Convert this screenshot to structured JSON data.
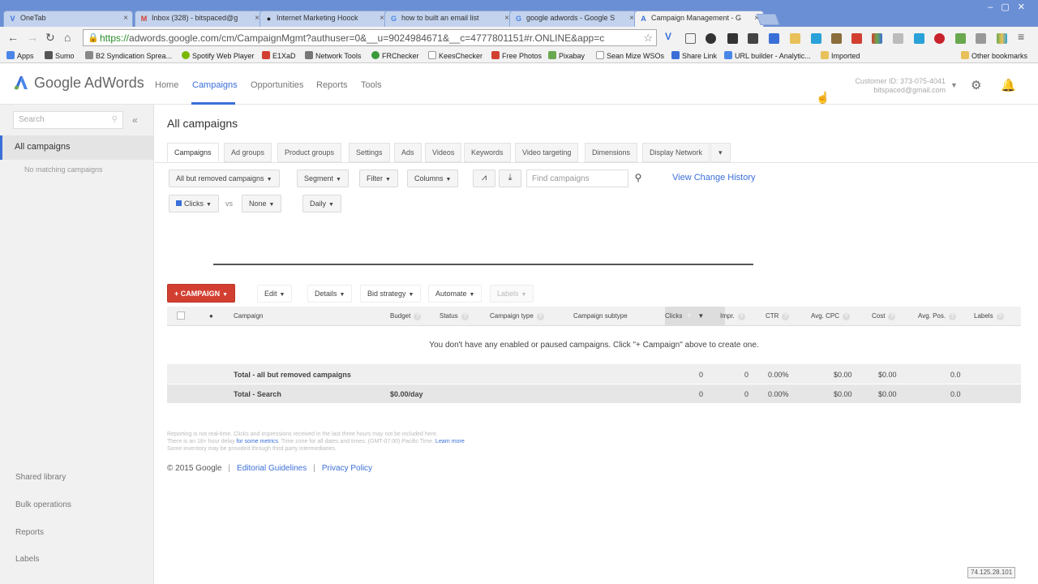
{
  "browser": {
    "tabs": [
      {
        "title": "OneTab",
        "icon": "V",
        "color": "#3a6fd8"
      },
      {
        "title": "Inbox (328) - bitspaced@g",
        "icon": "M",
        "color": "#d23f31"
      },
      {
        "title": "Internet Marketing Hoock",
        "icon": "●",
        "color": "#222"
      },
      {
        "title": "how to built an email list",
        "icon": "G",
        "color": "#4a86e8"
      },
      {
        "title": "google adwords - Google S",
        "icon": "G",
        "color": "#4a86e8"
      },
      {
        "title": "Campaign Management - G",
        "icon": "A",
        "color": "#3a6fd8"
      }
    ],
    "url_https": "https://",
    "url_rest": "adwords.google.com/cm/CampaignMgmt?authuser=0&__u=9024984671&__c=4777801151#r.ONLINE&app=c",
    "bookmarks": [
      {
        "label": "Apps",
        "color": "#4a86e8"
      },
      {
        "label": "Sumo",
        "color": "#555"
      },
      {
        "label": "B2 Syndication Sprea...",
        "color": "#888"
      },
      {
        "label": "Spotify Web Player",
        "color": "#7ab800"
      },
      {
        "label": "E1XaD",
        "color": "#d23f31"
      },
      {
        "label": "Network Tools",
        "color": "#777"
      },
      {
        "label": "FRChecker",
        "color": "#3a9a3a"
      },
      {
        "label": "KeesChecker",
        "color": "#888"
      },
      {
        "label": "Free Photos",
        "color": "#d23f31"
      },
      {
        "label": "Pixabay",
        "color": "#6aa84f"
      },
      {
        "label": "Sean Mize WSOs",
        "color": "#888"
      },
      {
        "label": "Share Link",
        "color": "#3a6fd8"
      },
      {
        "label": "URL builder - Analytic...",
        "color": "#4a86e8"
      },
      {
        "label": "Imported",
        "color": "#e8c15a"
      },
      {
        "label": "Other bookmarks",
        "color": "#e8c15a"
      }
    ]
  },
  "header": {
    "logo": "Google AdWords",
    "nav": [
      "Home",
      "Campaigns",
      "Opportunities",
      "Reports",
      "Tools"
    ],
    "customer_id": "Customer ID: 373-075-4041",
    "email": "bitspaced@gmail.com"
  },
  "sidebar": {
    "search_placeholder": "Search",
    "all_campaigns": "All campaigns",
    "no_match": "No matching campaigns",
    "links": [
      "Shared library",
      "Bulk operations",
      "Reports",
      "Labels"
    ]
  },
  "main": {
    "title": "All campaigns",
    "tabs": [
      "Campaigns",
      "Ad groups",
      "Product groups",
      "Settings",
      "Ads",
      "Videos",
      "Keywords",
      "Video targeting",
      "Dimensions",
      "Display Network",
      "▾"
    ],
    "filter_btn": "All but removed campaigns",
    "segment": "Segment",
    "filter": "Filter",
    "columns": "Columns",
    "find_placeholder": "Find campaigns",
    "change_history": "View Change History",
    "metric1": "Clicks",
    "vs": "vs",
    "metric2": "None",
    "period": "Daily",
    "campaign_btn": "+ CAMPAIGN",
    "edit": "Edit",
    "details": "Details",
    "bid_strategy": "Bid strategy",
    "automate": "Automate",
    "labels_btn": "Labels",
    "columns_head": [
      "●",
      "Campaign",
      "Budget",
      "Status",
      "Campaign type",
      "Campaign subtype",
      "Clicks",
      "Impr.",
      "CTR",
      "Avg. CPC",
      "Cost",
      "Avg. Pos.",
      "Labels"
    ],
    "empty_message": "You don't have any enabled or paused campaigns. Click \"+ Campaign\" above to create one.",
    "rows": [
      {
        "name": "Total - all but removed campaigns",
        "budget": "",
        "clicks": "0",
        "impr": "0",
        "ctr": "0.00%",
        "cpc": "$0.00",
        "cost": "$0.00",
        "pos": "0.0"
      },
      {
        "name": "Total - Search",
        "budget": "$0.00/day",
        "clicks": "0",
        "impr": "0",
        "ctr": "0.00%",
        "cpc": "$0.00",
        "cost": "$0.00",
        "pos": "0.0"
      }
    ],
    "footnote1": "Reporting is not real-time. Clicks and impressions received in the last three hours may not be included here.",
    "footnote2_a": "There is an 18+ hour delay",
    "footnote2_link": "for some metrics",
    "footnote2_b": ". Time zone for all dates and times: (GMT-07:00) Pacific Time.",
    "footnote2_learn": "Learn more",
    "footnote3": "Some inventory may be provided through third party intermediaries.",
    "copyright": "© 2015 Google",
    "editorial": "Editorial Guidelines",
    "privacy": "Privacy Policy"
  },
  "ip": "74.125.28.101"
}
